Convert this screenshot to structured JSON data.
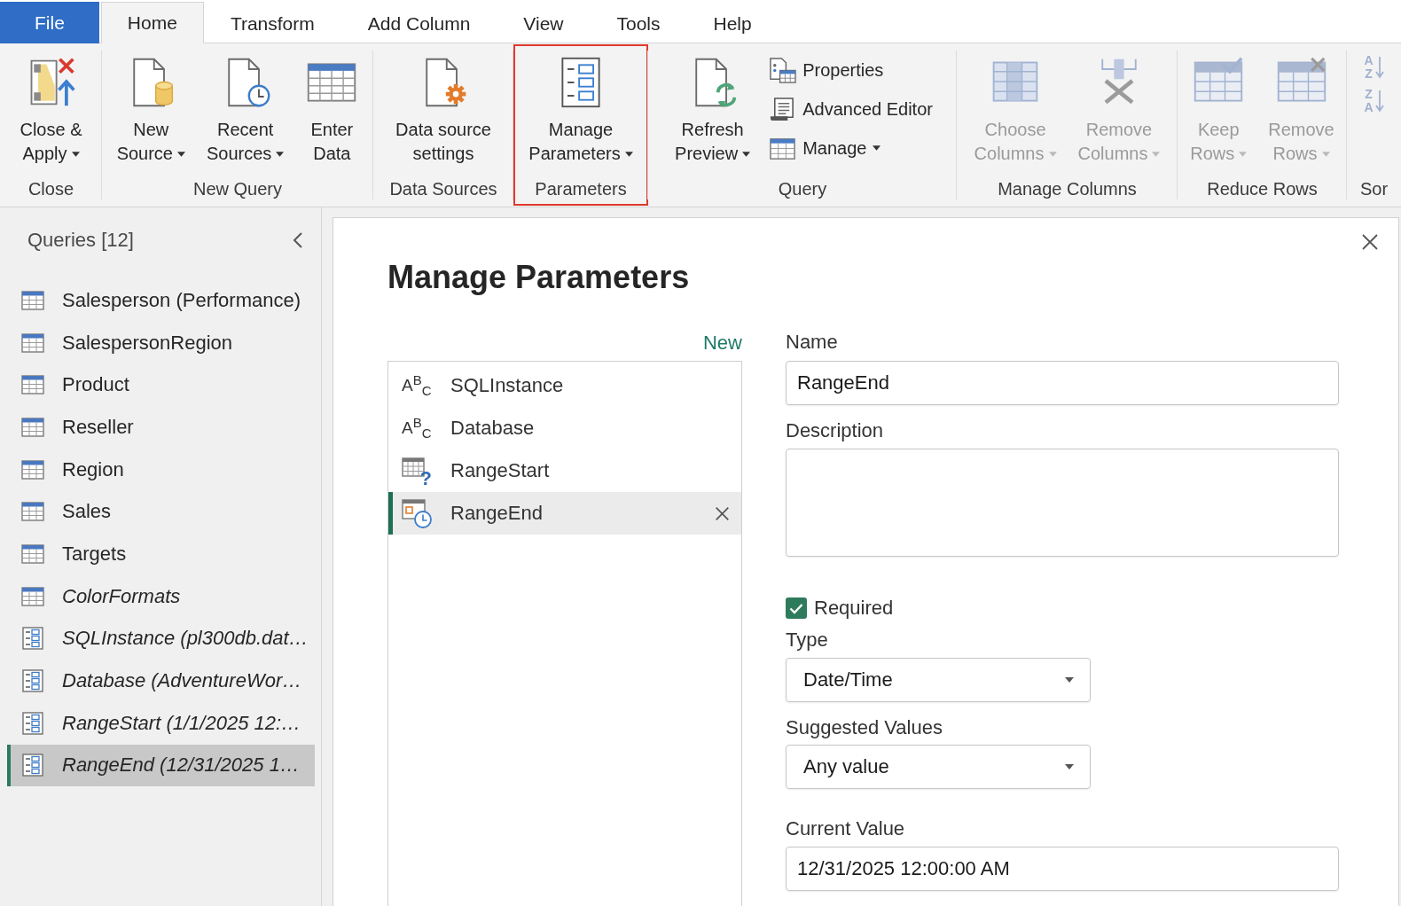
{
  "ribbon": {
    "tabs": [
      {
        "label": "File",
        "kind": "file",
        "selected": false
      },
      {
        "label": "Home",
        "kind": "tab",
        "selected": true
      },
      {
        "label": "Transform",
        "kind": "tab",
        "selected": false
      },
      {
        "label": "Add Column",
        "kind": "tab",
        "selected": false
      },
      {
        "label": "View",
        "kind": "tab",
        "selected": false
      },
      {
        "label": "Tools",
        "kind": "tab",
        "selected": false
      },
      {
        "label": "Help",
        "kind": "tab",
        "selected": false
      }
    ],
    "groups": [
      {
        "label": "Close",
        "highlighted": false,
        "buttons": [
          {
            "kind": "large",
            "lines": [
              "Close &",
              "Apply"
            ],
            "dropdown": true,
            "disabled": false
          }
        ]
      },
      {
        "label": "New Query",
        "highlighted": false,
        "buttons": [
          {
            "kind": "large",
            "lines": [
              "New",
              "Source"
            ],
            "dropdown": true,
            "disabled": false
          },
          {
            "kind": "large",
            "lines": [
              "Recent",
              "Sources"
            ],
            "dropdown": true,
            "disabled": false
          },
          {
            "kind": "large",
            "lines": [
              "Enter",
              "Data"
            ],
            "dropdown": false,
            "disabled": false
          }
        ]
      },
      {
        "label": "Data Sources",
        "highlighted": false,
        "buttons": [
          {
            "kind": "large",
            "lines": [
              "Data source",
              "settings"
            ],
            "dropdown": false,
            "disabled": false
          }
        ]
      },
      {
        "label": "Parameters",
        "highlighted": true,
        "buttons": [
          {
            "kind": "large",
            "lines": [
              "Manage",
              "Parameters"
            ],
            "dropdown": true,
            "disabled": false
          }
        ]
      },
      {
        "label": "Query",
        "highlighted": false,
        "buttons": [
          {
            "kind": "large",
            "lines": [
              "Refresh",
              "Preview"
            ],
            "dropdown": true,
            "disabled": false
          },
          {
            "kind": "small",
            "label": "Properties",
            "dropdown": false,
            "disabled": false
          },
          {
            "kind": "small",
            "label": "Advanced Editor",
            "dropdown": false,
            "disabled": false
          },
          {
            "kind": "small",
            "label": "Manage",
            "dropdown": true,
            "disabled": false
          }
        ]
      },
      {
        "label": "Manage Columns",
        "highlighted": false,
        "buttons": [
          {
            "kind": "large",
            "lines": [
              "Choose",
              "Columns"
            ],
            "dropdown": true,
            "disabled": true
          },
          {
            "kind": "large",
            "lines": [
              "Remove",
              "Columns"
            ],
            "dropdown": true,
            "disabled": true
          }
        ]
      },
      {
        "label": "Reduce Rows",
        "highlighted": false,
        "buttons": [
          {
            "kind": "large",
            "lines": [
              "Keep",
              "Rows"
            ],
            "dropdown": true,
            "disabled": true
          },
          {
            "kind": "large",
            "lines": [
              "Remove",
              "Rows"
            ],
            "dropdown": true,
            "disabled": true
          }
        ]
      },
      {
        "label": "Sor",
        "highlighted": false,
        "buttons": [
          {
            "kind": "sort",
            "letters": [
              "A",
              "Z"
            ],
            "dropdown": false,
            "disabled": true
          },
          {
            "kind": "sort",
            "letters": [
              "Z",
              "A"
            ],
            "dropdown": false,
            "disabled": true
          }
        ]
      }
    ]
  },
  "queries": {
    "title": "Queries [12]",
    "items": [
      {
        "name": "Salesperson (Performance)",
        "kind": "table",
        "load_enabled": true,
        "selected": false
      },
      {
        "name": "SalespersonRegion",
        "kind": "table",
        "load_enabled": true,
        "selected": false
      },
      {
        "name": "Product",
        "kind": "table",
        "load_enabled": true,
        "selected": false
      },
      {
        "name": "Reseller",
        "kind": "table",
        "load_enabled": true,
        "selected": false
      },
      {
        "name": "Region",
        "kind": "table",
        "load_enabled": true,
        "selected": false
      },
      {
        "name": "Sales",
        "kind": "table",
        "load_enabled": true,
        "selected": false
      },
      {
        "name": "Targets",
        "kind": "table",
        "load_enabled": true,
        "selected": false
      },
      {
        "name": "ColorFormats",
        "kind": "table",
        "load_enabled": false,
        "selected": false
      },
      {
        "name": "SQLInstance (pl300db.dat…",
        "kind": "parameter",
        "load_enabled": false,
        "selected": false
      },
      {
        "name": "Database (AdventureWor…",
        "kind": "parameter",
        "load_enabled": false,
        "selected": false
      },
      {
        "name": "RangeStart (1/1/2025 12:…",
        "kind": "parameter",
        "load_enabled": false,
        "selected": false
      },
      {
        "name": "RangeEnd (12/31/2025 1…",
        "kind": "parameter",
        "load_enabled": false,
        "selected": true
      }
    ]
  },
  "dialog": {
    "title": "Manage Parameters",
    "new_link": "New",
    "parameters": [
      {
        "name": "SQLInstance",
        "kind": "text",
        "glyph": "A$^{B}$$_{C}$",
        "selected": false
      },
      {
        "name": "Database",
        "kind": "text",
        "glyph": "A$^{B}$$_{C}$",
        "selected": false
      },
      {
        "name": "RangeStart",
        "kind": "any",
        "glyph": "?",
        "selected": false
      },
      {
        "name": "RangeEnd",
        "kind": "datetime",
        "selected": true
      }
    ],
    "form": {
      "name": {
        "label": "Name",
        "value": "RangeEnd"
      },
      "description": {
        "label": "Description"
      },
      "required": {
        "label": "Required",
        "checked": true
      },
      "type": {
        "label": "Type",
        "value": "Date/Time"
      },
      "suggested_values": {
        "label": "Suggested Values",
        "value": "Any value"
      },
      "current_value": {
        "label": "Current Value",
        "value": "12/31/2025 12:00:00 AM"
      }
    }
  }
}
